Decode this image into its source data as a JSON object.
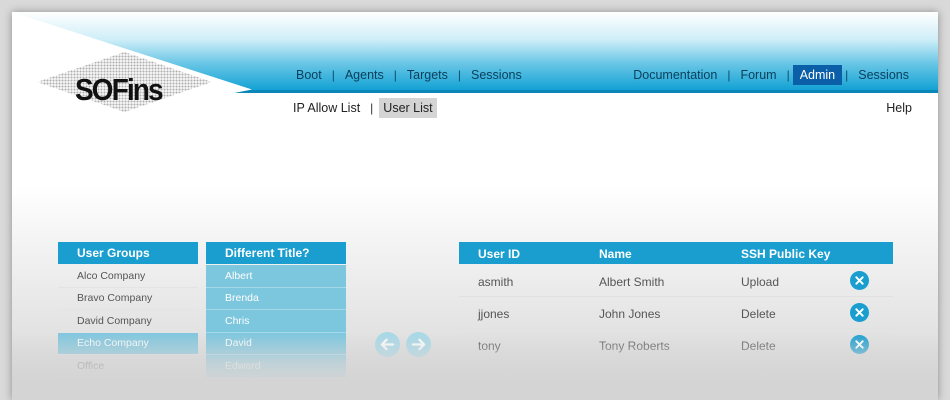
{
  "brand": {
    "logo_text": "SOFins"
  },
  "main_nav": [
    {
      "label": "Boot"
    },
    {
      "label": "Agents"
    },
    {
      "label": "Targets"
    },
    {
      "label": "Sessions"
    }
  ],
  "right_nav": [
    {
      "label": "Documentation"
    },
    {
      "label": "Forum"
    },
    {
      "label": "Admin",
      "active": true
    },
    {
      "label": "Sessions"
    }
  ],
  "sub_nav": [
    {
      "label": "IP Allow List"
    },
    {
      "label": "User List",
      "active": true
    }
  ],
  "help_label": "Help",
  "separator": "|",
  "user_groups": {
    "title": "User Groups",
    "items": [
      {
        "label": "Alco Company"
      },
      {
        "label": "Bravo Company"
      },
      {
        "label": "David Company"
      },
      {
        "label": "Echo Company",
        "selected": true
      },
      {
        "label": "Office"
      }
    ]
  },
  "titles": {
    "title": "Different Title?",
    "items": [
      {
        "label": "Albert"
      },
      {
        "label": "Brenda"
      },
      {
        "label": "Chris"
      },
      {
        "label": "David"
      },
      {
        "label": "Edward"
      }
    ]
  },
  "users_table": {
    "columns": [
      "User ID",
      "Name",
      "SSH Public Key"
    ],
    "rows": [
      {
        "user_id": "asmith",
        "name": "Albert Smith",
        "key_action": "Upload"
      },
      {
        "user_id": "jjones",
        "name": "John Jones",
        "key_action": "Delete"
      },
      {
        "user_id": "tony",
        "name": "Tony Roberts",
        "key_action": "Delete"
      }
    ]
  },
  "colors": {
    "accent": "#1a9ecf",
    "active_nav": "#0b5fa8",
    "nav_text": "#0a3f5c"
  },
  "icons": {
    "arrow_left": "arrow-left-circle-icon",
    "arrow_right": "arrow-right-circle-icon",
    "delete": "close-circle-icon"
  }
}
